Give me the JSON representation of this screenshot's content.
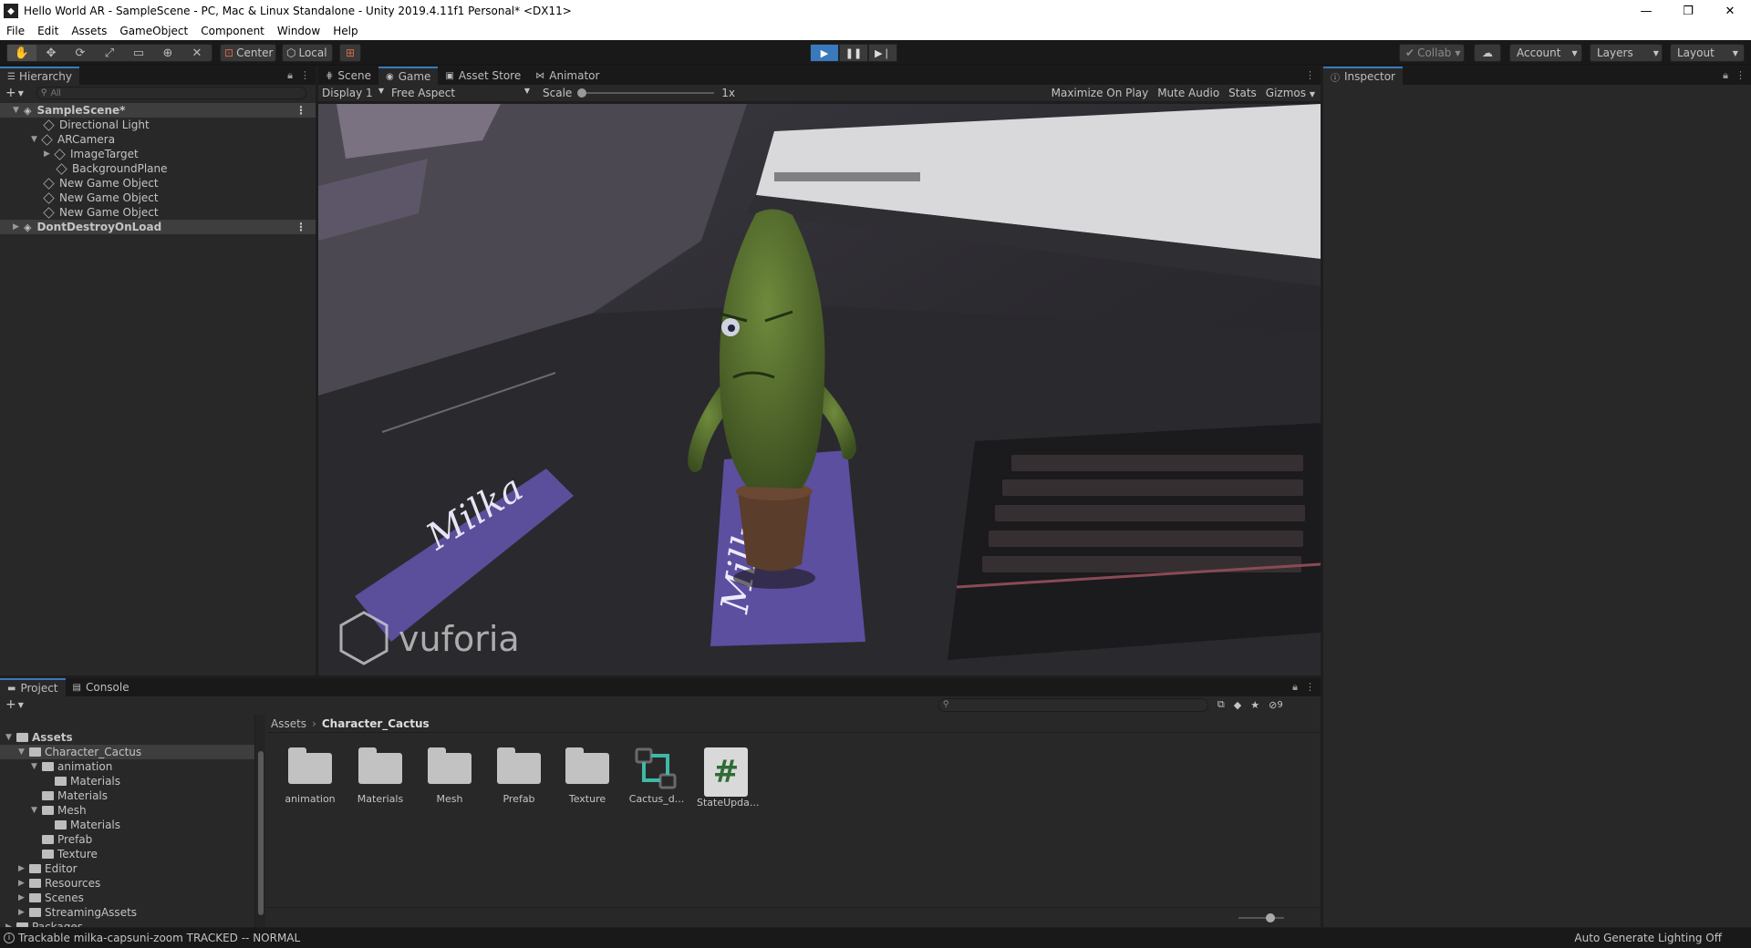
{
  "window": {
    "title": "Hello World AR - SampleScene - PC, Mac & Linux Standalone - Unity 2019.4.11f1 Personal* <DX11>",
    "app_icon": "unity-icon"
  },
  "menu": [
    "File",
    "Edit",
    "Assets",
    "GameObject",
    "Component",
    "Window",
    "Help"
  ],
  "toolbar": {
    "pivot": "Center",
    "space": "Local",
    "collab": "Collab",
    "account": "Account",
    "layers": "Layers",
    "layout": "Layout"
  },
  "hierarchy": {
    "tab": "Hierarchy",
    "search_placeholder": "All",
    "items": [
      {
        "label": "SampleScene*",
        "depth": 0,
        "head": true,
        "expanded": true
      },
      {
        "label": "Directional Light",
        "depth": 1
      },
      {
        "label": "ARCamera",
        "depth": 1,
        "expanded": true
      },
      {
        "label": "ImageTarget",
        "depth": 2,
        "collapsed": true
      },
      {
        "label": "BackgroundPlane",
        "depth": 2
      },
      {
        "label": "New Game Object",
        "depth": 1
      },
      {
        "label": "New Game Object",
        "depth": 1
      },
      {
        "label": "New Game Object",
        "depth": 1
      },
      {
        "label": "DontDestroyOnLoad",
        "depth": 0,
        "head": true,
        "collapsed": true
      }
    ]
  },
  "center_tabs": [
    "Scene",
    "Game",
    "Asset Store",
    "Animator"
  ],
  "center_active_tab": "Game",
  "game_bar": {
    "display": "Display 1",
    "aspect": "Free Aspect",
    "scale_label": "Scale",
    "scale_value": "1x",
    "maximize": "Maximize On Play",
    "mute": "Mute Audio",
    "stats": "Stats",
    "gizmos": "Gizmos"
  },
  "game_view": {
    "watermark": "vuforia",
    "candy_text": "Milka"
  },
  "inspector": {
    "tab": "Inspector"
  },
  "project": {
    "tabs": [
      "Project",
      "Console"
    ],
    "breadcrumb": [
      "Assets",
      "Character_Cactus"
    ],
    "visible_count": "9",
    "tree": [
      {
        "label": "Assets",
        "depth": 0,
        "bold": true
      },
      {
        "label": "Character_Cactus",
        "depth": 1,
        "selected": true
      },
      {
        "label": "animation",
        "depth": 2
      },
      {
        "label": "Materials",
        "depth": 3
      },
      {
        "label": "Materials",
        "depth": 2
      },
      {
        "label": "Mesh",
        "depth": 2
      },
      {
        "label": "Materials",
        "depth": 3
      },
      {
        "label": "Prefab",
        "depth": 2
      },
      {
        "label": "Texture",
        "depth": 2
      },
      {
        "label": "Editor",
        "depth": 1
      },
      {
        "label": "Resources",
        "depth": 1
      },
      {
        "label": "Scenes",
        "depth": 1
      },
      {
        "label": "StreamingAssets",
        "depth": 1
      },
      {
        "label": "Packages",
        "depth": 0
      }
    ],
    "assets": [
      {
        "label": "animation",
        "kind": "folder"
      },
      {
        "label": "Materials",
        "kind": "folder"
      },
      {
        "label": "Mesh",
        "kind": "folder"
      },
      {
        "label": "Prefab",
        "kind": "folder"
      },
      {
        "label": "Texture",
        "kind": "folder"
      },
      {
        "label": "Cactus_d...",
        "kind": "animator"
      },
      {
        "label": "StateUpda...",
        "kind": "script"
      }
    ]
  },
  "status": {
    "message": "Trackable milka-capsuni-zoom TRACKED -- NORMAL",
    "right": "Auto Generate Lighting Off"
  }
}
